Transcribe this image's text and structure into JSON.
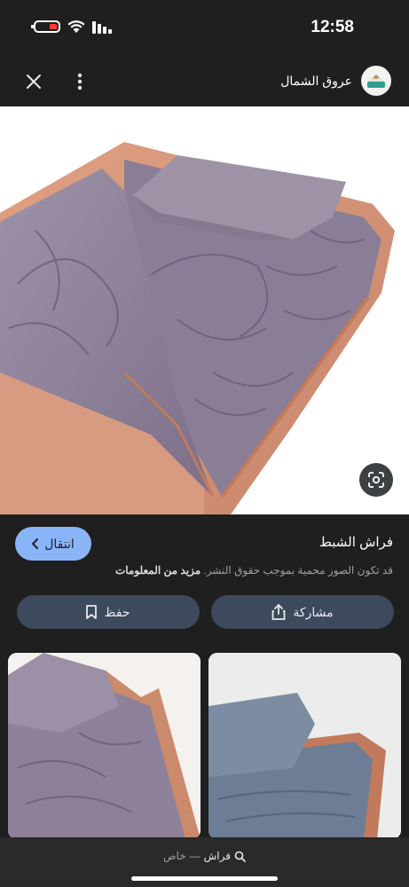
{
  "status_bar": {
    "time": "12:58"
  },
  "header": {
    "source_name": "عروق الشمال"
  },
  "result": {
    "title": "فراش الشبط",
    "notice_text": "قد تكون الصور محمية بموجب حقوق النشر.",
    "notice_link": "مزيد من المعلومات",
    "visit_label": "انتقال"
  },
  "actions": {
    "share_label": "مشاركة",
    "save_label": "حفظ"
  },
  "search_bar": {
    "query": "فراش",
    "separator": "—",
    "suffix": "خاص"
  },
  "colors": {
    "accent": "#8ab4f8",
    "action_bg": "#3c4a5c",
    "background": "#1f1f1f"
  }
}
